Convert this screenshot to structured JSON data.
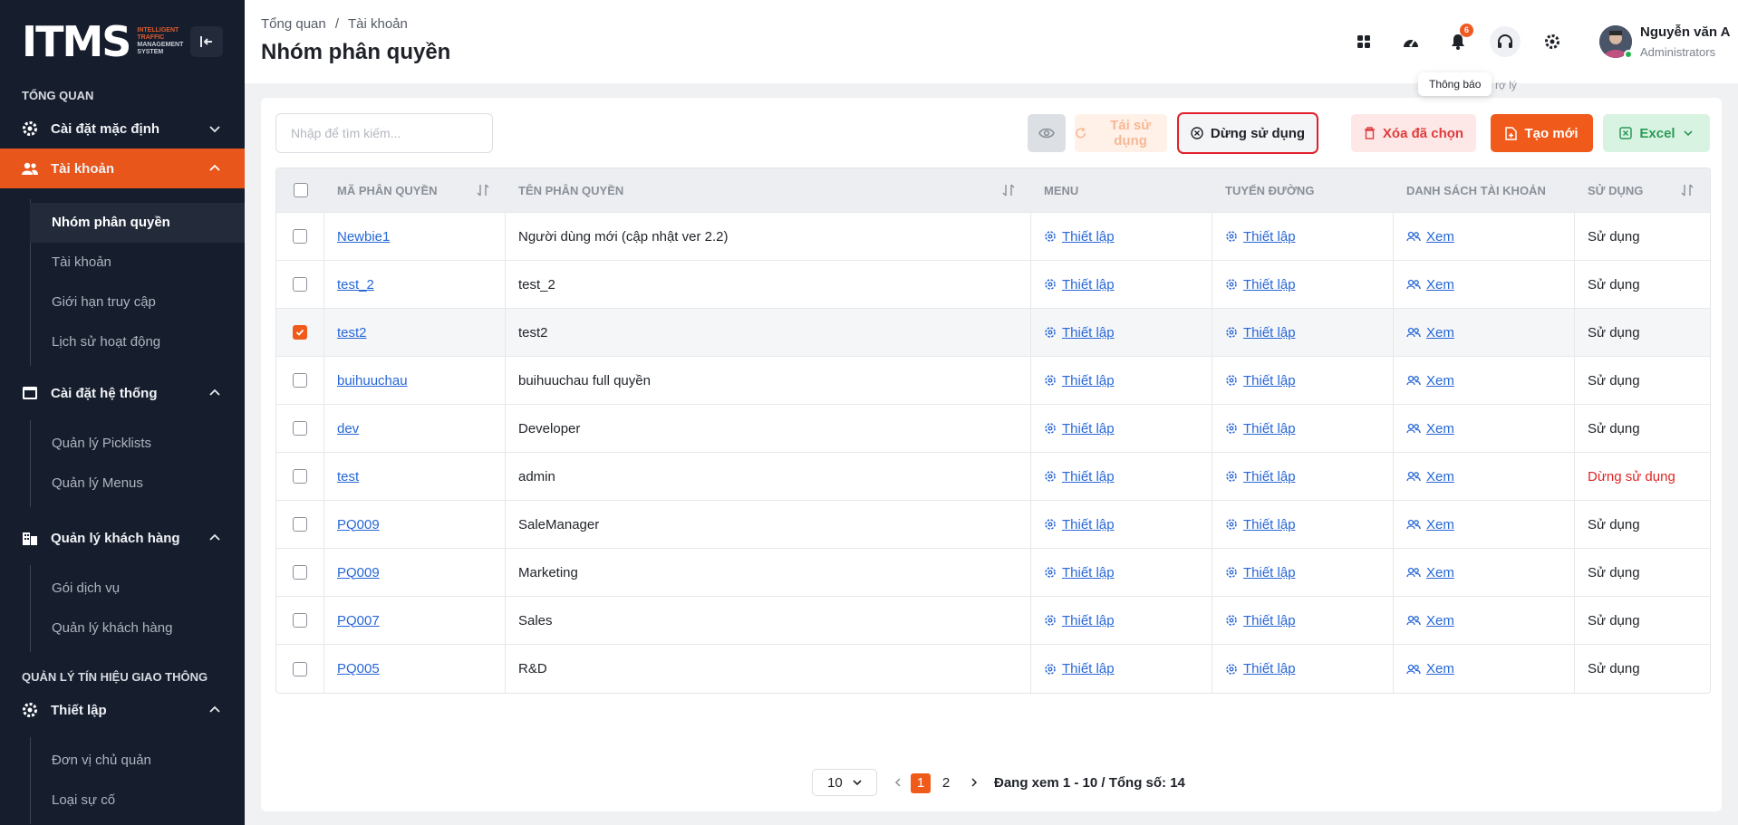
{
  "brand": {
    "logo": "ITMS",
    "line1": "INTELLIGENT",
    "line2": "TRAFFIC",
    "line3": "MANAGEMENT",
    "line4": "SYSTEM"
  },
  "sidebar": {
    "section_overview": "TỔNG QUAN",
    "menus": [
      {
        "label": "Cài đặt mặc định",
        "icon": "gear-icon"
      },
      {
        "label": "Tài khoản",
        "icon": "users-icon",
        "active": true
      },
      {
        "label": "Cài đặt hệ thống",
        "icon": "window-icon"
      },
      {
        "label": "Quản lý khách hàng",
        "icon": "building-icon"
      },
      {
        "label": "Thiết lập",
        "icon": "gear-icon"
      }
    ],
    "account_sub": [
      "Nhóm phân quyền",
      "Tài khoản",
      "Giới hạn truy cập",
      "Lịch sử hoạt động"
    ],
    "system_sub": [
      "Quản lý Picklists",
      "Quản lý Menus"
    ],
    "customer_sub": [
      "Gói dịch vụ",
      "Quản lý khách hàng"
    ],
    "section_signal": "QUẢN LÝ TÍN HIỆU GIAO THÔNG",
    "setup_sub": [
      "Đơn vị chủ quản",
      "Loại sự cố"
    ]
  },
  "header": {
    "breadcrumb": [
      "Tổng quan",
      "/",
      "Tài khoản"
    ],
    "title": "Nhóm phân quyền",
    "notification_count": "6",
    "tooltip": "Thông báo",
    "tooltip_ghost": "rợ lý",
    "user_name": "Nguyễn văn A",
    "user_role": "Administrators"
  },
  "toolbar": {
    "search_placeholder": "Nhập để tìm kiếm...",
    "reuse": "Tái sử dụng",
    "stop": "Dừng sử dụng",
    "delete": "Xóa đã chọn",
    "create": "Tạo mới",
    "excel": "Excel"
  },
  "table": {
    "columns": [
      "MÃ PHÂN QUYỀN",
      "TÊN PHÂN QUYỀN",
      "MENU",
      "TUYẾN ĐƯỜNG",
      "DANH SÁCH TÀI KHOẢN",
      "SỬ DỤNG"
    ],
    "setup_label": "Thiết lập",
    "view_label": "Xem",
    "rows": [
      {
        "code": "Newbie1",
        "name": "Người dùng mới (cập nhật ver 2.2)",
        "status": "Sử dụng",
        "checked": false
      },
      {
        "code": "test_2",
        "name": "test_2",
        "status": "Sử dụng",
        "checked": false
      },
      {
        "code": "test2",
        "name": "test2",
        "status": "Sử dụng",
        "checked": true
      },
      {
        "code": "buihuuchau",
        "name": "buihuuchau full quyền",
        "status": "Sử dụng",
        "checked": false
      },
      {
        "code": "dev",
        "name": "Developer",
        "status": "Sử dụng",
        "checked": false
      },
      {
        "code": "test",
        "name": "admin",
        "status": "Dừng sử dụng",
        "checked": false
      },
      {
        "code": "PQ009",
        "name": "SaleManager",
        "status": "Sử dụng",
        "checked": false
      },
      {
        "code": "PQ009",
        "name": "Marketing",
        "status": "Sử dụng",
        "checked": false
      },
      {
        "code": "PQ007",
        "name": "Sales",
        "status": "Sử dụng",
        "checked": false
      },
      {
        "code": "PQ005",
        "name": "R&D",
        "status": "Sử dụng",
        "checked": false
      }
    ]
  },
  "pagination": {
    "page_size": "10",
    "pages": [
      "1",
      "2"
    ],
    "current": "1",
    "info": "Đang xem 1 - 10 / Tổng số: 14"
  },
  "colors": {
    "accent": "#f05a1a",
    "sidebar_bg": "#161e2e",
    "link": "#2767d8",
    "danger": "#e02424",
    "highlight_box": "#e0202b"
  }
}
